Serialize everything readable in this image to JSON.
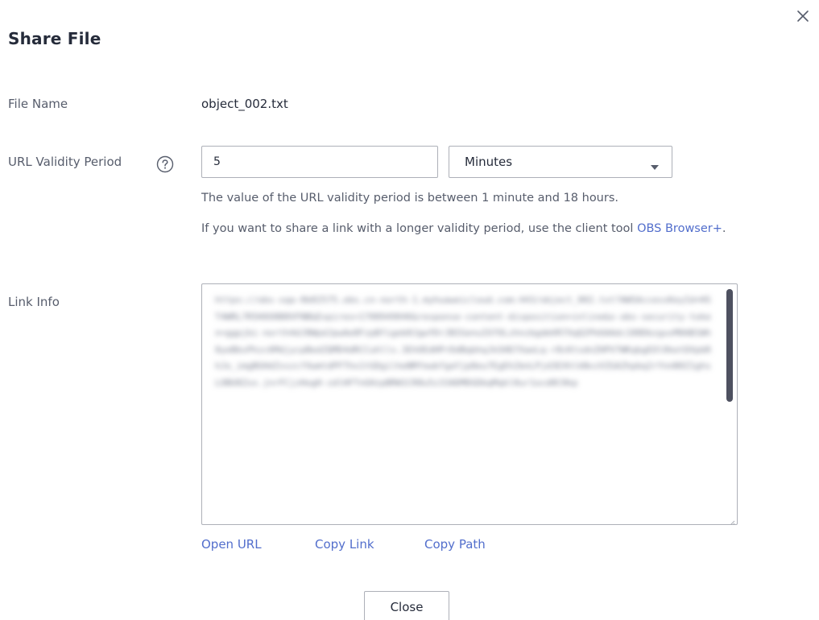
{
  "dialog": {
    "title": "Share File",
    "close_icon": "close-icon"
  },
  "file_name": {
    "label": "File Name",
    "value": "object_002.txt"
  },
  "validity": {
    "label": "URL Validity Period",
    "help_icon": "question-circle-icon",
    "value": "5",
    "unit_selected": "Minutes",
    "hint": "The value of the URL validity period is between 1 minute and 18 hours.",
    "hint2_prefix": "If you want to share a link with a longer validity period, use the client tool ",
    "hint2_link": "OBS Browser+",
    "hint2_suffix": "."
  },
  "link_info": {
    "label": "Link Info",
    "blurred_text": "https://obs-sqa-0b02575.obs.cn-north-1.myhuaweicloud.com:443/object_002.txt?AWSAccessKeyId=HST4WRL7R5HOO8B8VFNB&Expires=1708949046&response-content-disposition=inline&x-obs-security-token=ggpjbi-north4dJ8WpdJpwAe8FzpBfigeb0JgwYDrJBIGenuIO7OLzhnzbgdmVR7XqQ2Pk6AAdc188DbzguvM0AB1Wh0yeBbsPhzc6MdjycpBedZQMD4dRCCuhlls.3EhOEdHPrDdBqbhqJkSHD7XaeLq-r8cKtsdnZHPV7WKqbgEOl0ketDXpbRhJo_imgBGHdZsszcfXwmtdPFThx1tGDgilheNMfewbfgaYjp8eu7EgEh2bnLPjd3EXhlkNvzVZGAZhpbq2rYnnN9Z1ghsLOBU8Zxx.jnrFCjzHogH-zdlHFTnGHzpBRW1CR8u5z33ADMDGDbqMqkl0ur1ocd8C0kp"
  },
  "actions": {
    "open_url": "Open URL",
    "copy_link": "Copy Link",
    "copy_path": "Copy Path"
  },
  "footer": {
    "close_label": "Close"
  },
  "colors": {
    "accent_link": "#526ecc",
    "label_text": "#575d6c",
    "border": "#adb0b8",
    "scrollbar": "#4e5160"
  }
}
